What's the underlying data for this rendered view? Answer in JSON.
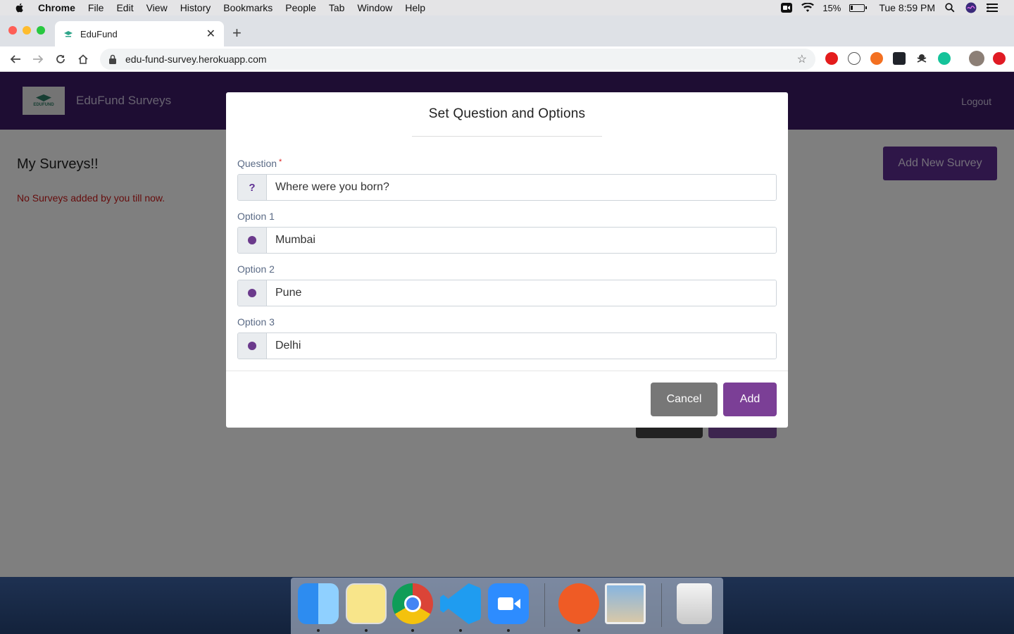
{
  "menubar": {
    "app": "Chrome",
    "items": [
      "File",
      "Edit",
      "View",
      "History",
      "Bookmarks",
      "People",
      "Tab",
      "Window",
      "Help"
    ],
    "battery": "15%",
    "battery_level": 0.15,
    "clock": "Tue 8:59 PM"
  },
  "browser": {
    "tab_title": "EduFund",
    "url": "edu-fund-survey.herokuapp.com"
  },
  "app": {
    "logo_text": "EDUFUND",
    "brand": "EduFund Surveys",
    "logout": "Logout",
    "heading": "My Surveys!!",
    "empty_message": "No Surveys added by you till now.",
    "add_new": "Add New Survey"
  },
  "modal": {
    "title": "Set Question and Options",
    "question_label": "Question",
    "required_mark": "*",
    "question_icon": "?",
    "question_value": "Where were you born?",
    "options": [
      {
        "label": "Option 1",
        "value": "Mumbai"
      },
      {
        "label": "Option 2",
        "value": "Pune"
      },
      {
        "label": "Option 3",
        "value": "Delhi"
      }
    ],
    "cancel": "Cancel",
    "add": "Add"
  },
  "colors": {
    "brand_purple": "#3c1b66",
    "accent_purple": "#7b3f96",
    "error_red": "#cc1a1a"
  }
}
